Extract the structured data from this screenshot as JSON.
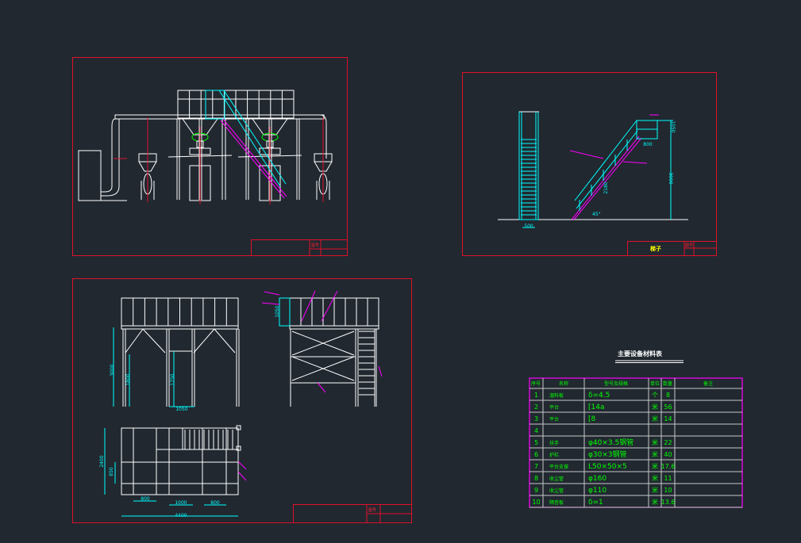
{
  "colors": {
    "background": "#212830",
    "frame": "#e0102a",
    "geometry": "#ffffff",
    "dimension": "#00ffff",
    "leader": "#ff00ff",
    "table_text": "#00ff00",
    "table_border": "#ff00ff"
  },
  "drawing1": {
    "title_block": {
      "mark": "图号"
    }
  },
  "drawing2": {
    "title_block": {
      "title": "梯子",
      "mark": "图号"
    },
    "dims": {
      "ladder_width": "500",
      "top_width": "800",
      "rail_height": "1050",
      "stair_height": "3000",
      "stair_length": "2180",
      "angle": "45°"
    }
  },
  "drawing3": {
    "title_block": {
      "mark": "图号"
    },
    "dims": {
      "total_height": "3000",
      "leg_a": "1800",
      "leg_b": "1750",
      "leg_gap": "1050",
      "rail_height": "1050",
      "plan_depth": "2400",
      "plan_inner": "850",
      "span1": "800",
      "span2": "1000",
      "span3": "800",
      "total_length": "4400"
    }
  },
  "material_table": {
    "title": "主要设备材料表",
    "headers": [
      "序号",
      "名称",
      "型号及规格",
      "单位",
      "数量",
      "备注"
    ],
    "rows": [
      {
        "no": "1",
        "name": "溜料板",
        "spec": "δ=4.5",
        "unit": "个",
        "qty": "8",
        "note": ""
      },
      {
        "no": "2",
        "name": "平台",
        "spec": "[14a",
        "unit": "米",
        "qty": "56",
        "note": ""
      },
      {
        "no": "3",
        "name": "平台",
        "spec": "[8",
        "unit": "米",
        "qty": "14",
        "note": ""
      },
      {
        "no": "4",
        "name": "",
        "spec": "",
        "unit": "",
        "qty": "",
        "note": ""
      },
      {
        "no": "5",
        "name": "扶手",
        "spec": "φ40×3.5钢管",
        "unit": "米",
        "qty": "22",
        "note": ""
      },
      {
        "no": "6",
        "name": "护栏",
        "spec": "φ30×3钢管",
        "unit": "米",
        "qty": "40",
        "note": ""
      },
      {
        "no": "7",
        "name": "平台支撑",
        "spec": "L50×50×5",
        "unit": "米",
        "qty": "17.6",
        "note": ""
      },
      {
        "no": "8",
        "name": "收尘管",
        "spec": "φ160",
        "unit": "米",
        "qty": "11",
        "note": ""
      },
      {
        "no": "9",
        "name": "收尘管",
        "spec": "φ110",
        "unit": "米",
        "qty": "10",
        "note": ""
      },
      {
        "no": "10",
        "name": "隔音板",
        "spec": "δ=1",
        "unit": "米",
        "qty": "13.6",
        "note": ""
      }
    ]
  }
}
